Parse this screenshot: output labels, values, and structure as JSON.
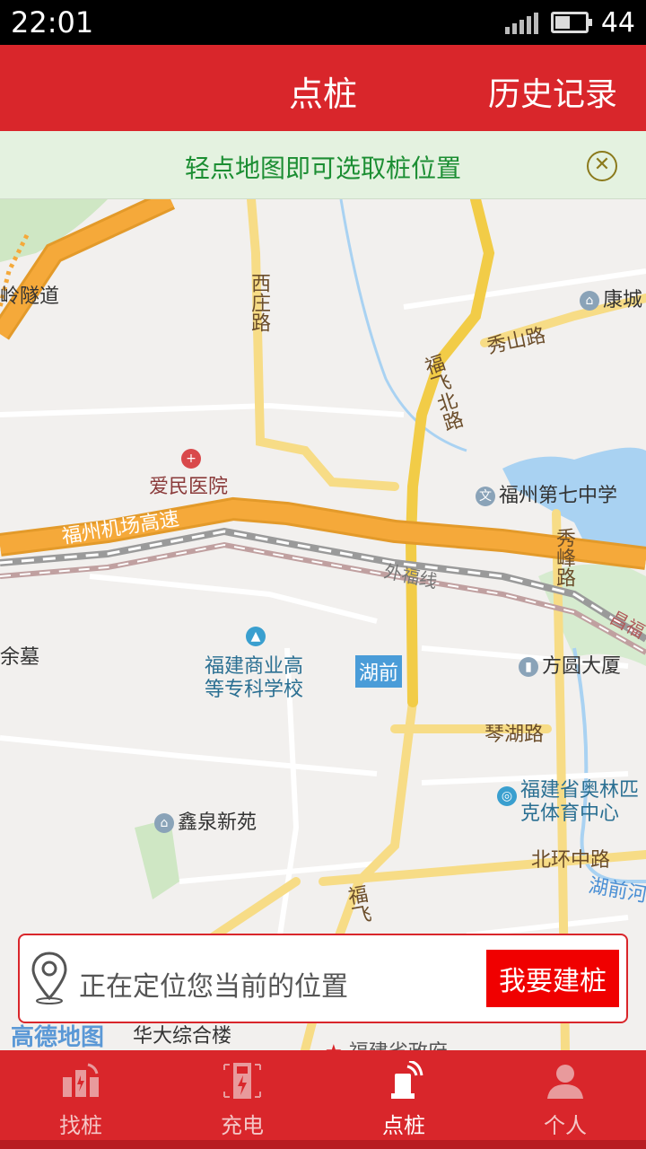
{
  "status_bar": {
    "time": "22:01",
    "battery": "44"
  },
  "header": {
    "title": "点桩",
    "history_label": "历史记录"
  },
  "tip": {
    "text": "轻点地图即可选取桩位置",
    "close_icon": "close-circle-icon"
  },
  "map": {
    "labels": {
      "tunnel": "岭隧道",
      "xizhuang_road": "西庄路",
      "kangcheng": "康城",
      "xiushan_road": "秀山路",
      "fufei_north_road": "福飞北路",
      "aimin_hospital": "爱民医院",
      "no7_middle_school": "福州第七中学",
      "airport_expressway": "福州机场高速",
      "xiufeng_road": "秀峰路",
      "waifu_line": "外福线",
      "changfu": "昌福",
      "tomb": "余墓",
      "business_school_1": "福建商业高",
      "business_school_2": "等专科学校",
      "huqian_metro": "湖前",
      "fangyuan_building": "方圆大厦",
      "qinhu_road": "琴湖路",
      "olympic_center_1": "福建省奥林匹",
      "olympic_center_2": "克体育中心",
      "xinquan_garden": "鑫泉新苑",
      "beihuan_road": "北环中路",
      "huqian_river": "湖前河",
      "fufei_road": "福飞",
      "huada_building": "华大综合楼",
      "provincial_gov": "福建省政府"
    },
    "logo": "高德地图"
  },
  "location_card": {
    "text": "正在定位您当前的位置",
    "button_label": "我要建桩"
  },
  "nav": {
    "items": [
      {
        "label": "找桩",
        "icon": "find-pile-icon",
        "active": false
      },
      {
        "label": "充电",
        "icon": "charging-icon",
        "active": false
      },
      {
        "label": "点桩",
        "icon": "mark-pile-icon",
        "active": true
      },
      {
        "label": "个人",
        "icon": "person-icon",
        "active": false
      }
    ]
  },
  "colors": {
    "brand_red": "#d9262b",
    "button_red": "#f00000",
    "tip_green": "#1c8e33",
    "tip_bg": "#e4f2e0"
  }
}
